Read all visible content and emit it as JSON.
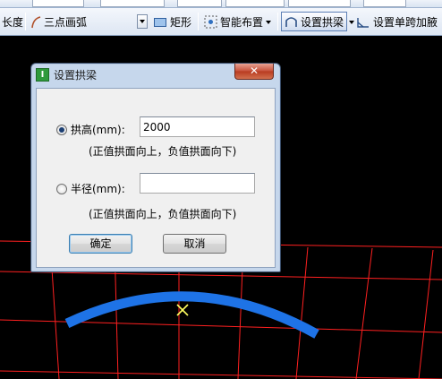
{
  "toolbar": {
    "length_label": "长度",
    "arc_tool_label": "三点画弧",
    "rect_tool_label": "矩形",
    "smart_layout_label": "智能布置",
    "set_arch_beam_label": "设置拱梁",
    "set_single_span_label": "设置单跨加腋"
  },
  "dialog": {
    "title": "设置拱梁",
    "close_glyph": "✕",
    "arch_height": {
      "label": "拱高(mm):",
      "value": "2000",
      "hint": "(正值拱面向上，负值拱面向下)",
      "checked": true
    },
    "radius": {
      "label": "半径(mm):",
      "value": "",
      "hint": "(正值拱面向上，负值拱面向下)",
      "checked": false
    },
    "ok_label": "确定",
    "cancel_label": "取消"
  },
  "colors": {
    "canvas_bg": "#000000",
    "grid_line": "#ff2020",
    "beam": "#1e73e6",
    "marker": "#ffff60"
  }
}
